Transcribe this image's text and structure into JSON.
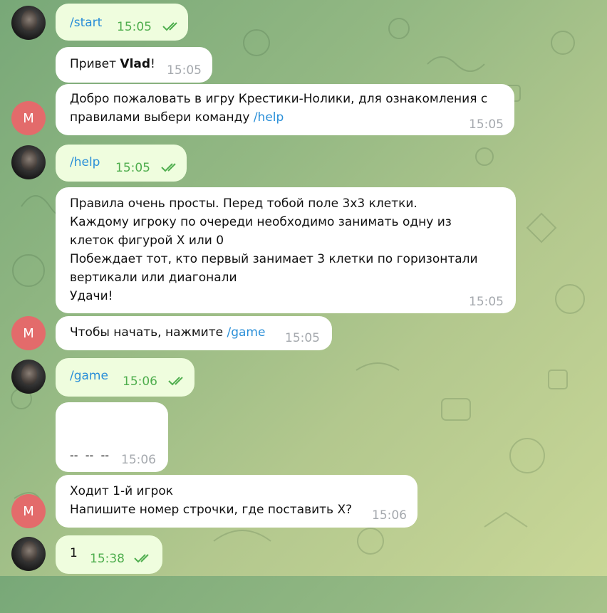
{
  "messages": {
    "m1": {
      "text": "/start",
      "time": "15:05"
    },
    "m2": {
      "prefix": "Привет ",
      "name": "Vlad",
      "suffix": "!",
      "time": "15:05"
    },
    "m3": {
      "line1": "Добро пожаловать в игру Крестики-Нолики, для ознакомления с",
      "line2_text": "правилами выбери команду ",
      "line2_link": "/help",
      "time": "15:05",
      "avatar": "M"
    },
    "m4": {
      "text": "/help",
      "time": "15:05"
    },
    "m5": {
      "lines": [
        "Правила очень просты. Перед тобой поле 3x3 клетки.",
        "Каждому игроку по очереди необходимо занимать одну из",
        "клеток фигурой X или 0",
        "Побеждает тот, кто первый занимает 3 клетки по горизонтали",
        "вертикали или диагонали",
        "Удачи!"
      ],
      "time": "15:05"
    },
    "m6": {
      "text": "Чтобы начать, нажмите ",
      "link": "/game",
      "time": "15:05",
      "avatar": "M"
    },
    "m7": {
      "text": "/game",
      "time": "15:06"
    },
    "m8": {
      "lines": [
        "--  --  --",
        "--  --  --",
        "--  --  --"
      ],
      "time": "15:06"
    },
    "m9": {
      "line1": "Ходит 1-й игрок",
      "line2": "Напишите номер строчки, где поставить X?",
      "time": "15:06",
      "avatar": "M"
    },
    "m10": {
      "text": "1",
      "time": "15:38"
    }
  },
  "colors": {
    "outgoing": "#effdde",
    "incoming": "#ffffff",
    "link": "#2a8fd8",
    "avatar_letter_bg": "#e36b6b"
  }
}
